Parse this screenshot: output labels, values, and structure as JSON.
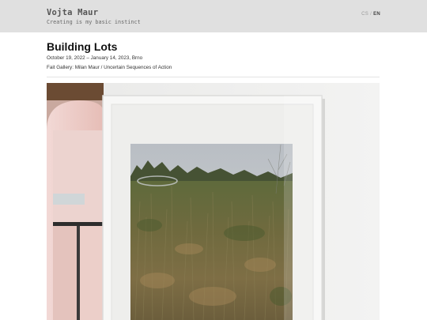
{
  "header": {
    "site_title": "Vojta Maur",
    "tagline": "Creating is my basic instinct",
    "languages": [
      {
        "code": "CS",
        "active": false
      },
      {
        "code": "EN",
        "active": true
      }
    ],
    "lang_separator": "/"
  },
  "article": {
    "title": "Building Lots",
    "dates": "October 19, 2022 – January 14, 2023, Brno",
    "venue": "Fait Gallery: Milan Maur / Uncertain Sequences of Action"
  },
  "photo": {
    "subject": "framed-landscape-photograph-on-gallery-wall"
  },
  "colors": {
    "header_bg": "#e0e0e0",
    "title_text": "#111111",
    "meta_text": "#333333"
  }
}
